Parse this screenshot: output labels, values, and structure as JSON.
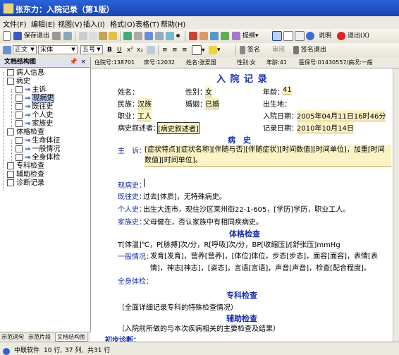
{
  "window": {
    "title": "张东力：入院记录（第1版）"
  },
  "menu": [
    "文件(F)",
    "编辑(E)",
    "视图(V)",
    "插入(I)",
    "格式(O)",
    "表格(T)",
    "帮助(H)"
  ],
  "toolbar1": {
    "save_exit": "保存退出",
    "submit": "提纲",
    "help": "说明",
    "exit": "退出(X)"
  },
  "toolbar2": {
    "style": "正文",
    "font": "宋体",
    "size": "五号",
    "sign": "签名",
    "review": "审阅",
    "sign_exit": "签名退出"
  },
  "patient_bar": {
    "bed_label": "住院号:138701",
    "room": "床号:12032",
    "name": "姓名:张爱国",
    "gender": "性别:女",
    "age": "年龄:41",
    "insurance": "医保号:01430557/病况:一般"
  },
  "left_panel": {
    "title": "文档结构图",
    "pin": "📌",
    "close": "×",
    "tree": [
      {
        "label": "病人信息",
        "level": 0
      },
      {
        "label": "病史",
        "level": 0
      },
      {
        "label": "主诉",
        "level": 1
      },
      {
        "label": "现病史",
        "level": 1,
        "selected": true
      },
      {
        "label": "既往史",
        "level": 1
      },
      {
        "label": "个人史",
        "level": 1
      },
      {
        "label": "家族史",
        "level": 1
      },
      {
        "label": "体格检查",
        "level": 0
      },
      {
        "label": "生命体征",
        "level": 1
      },
      {
        "label": "一般情况",
        "level": 1
      },
      {
        "label": "全身体检",
        "level": 1
      },
      {
        "label": "专科检查",
        "level": 0
      },
      {
        "label": "辅助检查",
        "level": 0
      },
      {
        "label": "诊断记录",
        "level": 0
      }
    ],
    "tabs": [
      "示范词句",
      "示范片段",
      "文档结构图"
    ]
  },
  "document": {
    "title": "入 院 记 录",
    "name_label": "姓名：",
    "gender_label": "性别：",
    "gender_val": "女",
    "age_label": "年龄：",
    "age_val": "41",
    "ethnic_label": "民族：",
    "ethnic_val": "汉族",
    "marital_label": "婚姻：",
    "marital_val": "已婚",
    "birth_label": "出生地：",
    "job_label": "职业：",
    "job_val": "工人",
    "admit_label": "入院日期：",
    "admit_val": "2005年04月11日16时46分",
    "narrator_label": "病史叙述者：",
    "narrator_val": "[病史叙述者]",
    "record_label": "记录日期：",
    "record_val": "2010年10月14日",
    "history_header": "病　史",
    "chief_label": "主　诉：",
    "chief_val": "[症状特点][症状名称][伴随与否][伴随症状][时间数值][时间单位]，加重[时间数值][时间单位]。",
    "present_label": "现病史：",
    "past_label": "既往史：",
    "past_val": "过去[体质]，无特殊病史。",
    "personal_label": "个人史：",
    "personal_val": "出生大连市，现住沙区莱州街22-1-605，[学历]学历，职业工人。",
    "family_label": "家族史：",
    "family_val": "父母健在，否认家族中有相同疾病史。",
    "exam_header": "体格检查",
    "vitals_val": "T[体温]℃，P[脉搏]次/分，R[呼吸]次/分，BP[收缩压]/[舒张压]mmHg",
    "general_label": "一般情况：",
    "general_val": "发育[发育]，营养[营养]，[体位]体位，步态[步态]，面容[面容]，表情[表情]，神志[神志]，[姿态]，言语[言语]，声音[声音]，检查[配合程度]。",
    "body_label": "全身体检：",
    "specialist_header": "专科检查",
    "specialist_val": "（全面详细记录专科的特殊检查情况）",
    "aux_header": "辅助检查",
    "aux_val": "（入院前所做的与本次疾病相关的主要检查及结果）",
    "diag_label": "初步诊断："
  },
  "statusbar": {
    "company": "中联软件",
    "row": "10 行,",
    "col": "37 列,",
    "total": "共31 行"
  }
}
